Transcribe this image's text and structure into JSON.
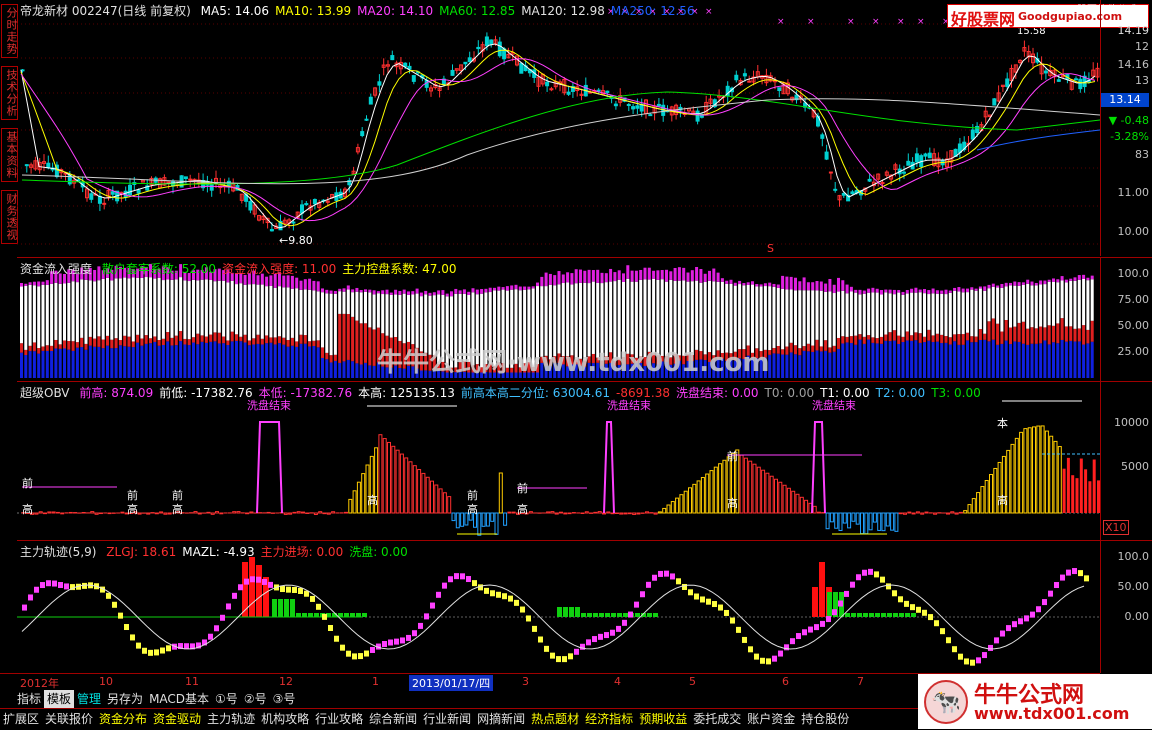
{
  "sidebar": {
    "tabs": [
      "分时走势",
      "技术分析",
      "基本资料",
      "财务透视"
    ]
  },
  "main": {
    "stock": "帝龙新材 002247(日线 前复权)",
    "ma": [
      {
        "label": "MA5: 14.06",
        "color": "#ffffff"
      },
      {
        "label": "MA10: 13.99",
        "color": "#ffff00"
      },
      {
        "label": "MA20: 14.10",
        "color": "#ff40ff"
      },
      {
        "label": "MA60: 12.85",
        "color": "#00e000"
      },
      {
        "label": "MA120: 12.98",
        "color": "#e0e0e0"
      },
      {
        "label": "MA250: 12.56",
        "color": "#2060ff"
      }
    ],
    "axis": [
      "14.19",
      "12",
      "14.16",
      "13",
      "12.00",
      "11.00",
      "10.00"
    ],
    "price_box": "13.14",
    "change": "▼ -0.48",
    "change_pct": "-3.28%",
    "volume_small": "83",
    "low_label": "9.80",
    "high_label": "15.58",
    "logo": {
      "text": "好股票网",
      "url": "Goodgupiao.com",
      "corner": "股票软件公式"
    }
  },
  "panel2": {
    "title": "资金流入强度",
    "items": [
      {
        "label": "散户套牢系数: 52.00",
        "color": "#00e000"
      },
      {
        "label": "资金流入强度: 11.00",
        "color": "#ff3030"
      },
      {
        "label": "主力控盘系数: 47.00",
        "color": "#ffff00"
      }
    ],
    "axis": [
      "100.0",
      "75.00",
      "50.00",
      "25.00"
    ],
    "watermark": "牛牛公式网·www.tdx001.com"
  },
  "panel3": {
    "title": "超级OBV",
    "items": [
      {
        "label": "前高: 874.09",
        "color": "#ff40ff"
      },
      {
        "label": "前低: -17382.76",
        "color": "#ffffff"
      },
      {
        "label": "本低: -17382.76",
        "color": "#ff40ff"
      },
      {
        "label": "本高: 125135.13",
        "color": "#ffffff"
      },
      {
        "label": "前高本高二分位: 63004.61",
        "color": "#40c0ff"
      },
      {
        "label": "-8691.38",
        "color": "#ff3030"
      },
      {
        "label": "洗盘结束: 0.00",
        "color": "#ff40ff"
      },
      {
        "label": "T0: 0.00",
        "color": "#a0a0a0"
      },
      {
        "label": "T1: 0.00",
        "color": "#ffffff"
      },
      {
        "label": "T2: 0.00",
        "color": "#40c0ff"
      },
      {
        "label": "T3: 0.00",
        "color": "#00e000"
      }
    ],
    "axis": [
      "10000",
      "5000"
    ],
    "x10": "X10",
    "washout_label": "洗盘结束",
    "front_label": "前",
    "high_label": "高",
    "this_label": "本"
  },
  "panel4": {
    "title": "主力轨迹(5,9)",
    "items": [
      {
        "label": "ZLGJ: 18.61",
        "color": "#ff3030"
      },
      {
        "label": "MAZL: -4.93",
        "color": "#ffffff"
      },
      {
        "label": "主力进场: 0.00",
        "color": "#ff3030"
      },
      {
        "label": "洗盘: 0.00",
        "color": "#00e000"
      }
    ],
    "axis": [
      "100.0",
      "50.00",
      "0.00"
    ]
  },
  "timeline": {
    "labels": [
      "2012年",
      "10",
      "11",
      "12",
      "1",
      "2013/01/17/四",
      "3",
      "4",
      "5",
      "6",
      "7"
    ]
  },
  "tabs": [
    "指标",
    "模板",
    "管理",
    "另存为",
    "MACD基本",
    "①号",
    "②号",
    "③号"
  ],
  "bottom_tabs": [
    "扩展区",
    "关联报价",
    "资金分布",
    "资金驱动",
    "主力轨迹",
    "机构攻略",
    "行业攻略",
    "综合新闻",
    "行业新闻",
    "网摘新闻",
    "热点题材",
    "经济指标",
    "预期收益",
    "委托成交",
    "账户资金",
    "持仓股份"
  ],
  "brand": {
    "name": "牛牛公式网",
    "url": "www.tdx001.com"
  },
  "colors": {
    "up": "#ff3030",
    "down": "#00e0e0",
    "axis": "#a00000",
    "accent": "#ff40ff"
  }
}
